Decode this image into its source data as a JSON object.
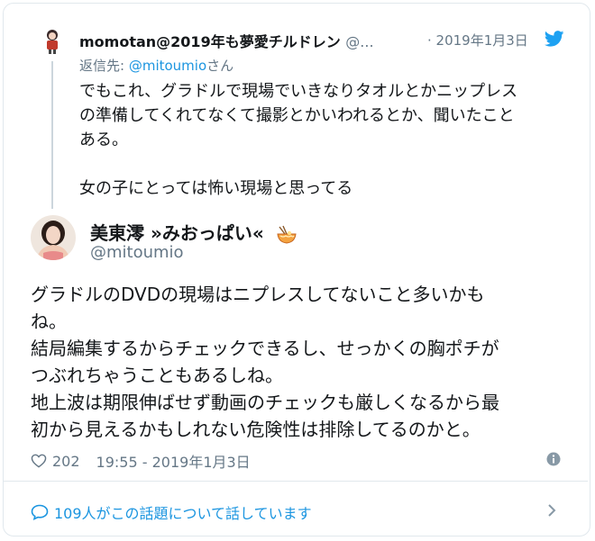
{
  "reply": {
    "display_name": "momotan@2019年も夢愛チルドレン",
    "handle": "@...",
    "date": "· 2019年1月3日",
    "reply_prefix": "返信先: ",
    "reply_mention": "@mitoumio",
    "reply_suffix": "さん",
    "text": "でもこれ、グラドルで現場でいきなりタオルとかニップレス\nの準備してくれてなくて撮影とかいわれるとか、聞いたこと\nある。\n\n女の子にとっては怖い現場と思ってる"
  },
  "tweet": {
    "display_name": "美東澪 »みおっぱい«",
    "handle": "@mitoumio",
    "text": "グラドルのDVDの現場はニプレスしてないこと多いかも\nね。\n結局編集するからチェックできるし、せっかくの胸ポチが\nつぶれちゃうこともあるしね。\n地上波は期限伸ばせず動画のチェックも厳しくなるから最\n初から見えるかもしれない危険性は排除してるのかと。",
    "likes": "202",
    "timestamp": "19:55 - 2019年1月3日"
  },
  "footer": {
    "label": "109人がこの話題について話しています"
  },
  "icons": {
    "bird": "twitter-bird-icon",
    "heart": "heart-icon",
    "info": "info-icon",
    "bubble": "speech-bubble-icon",
    "chevron": "chevron-right-icon",
    "ramen": "ramen-bowl-icon"
  },
  "colors": {
    "accent": "#1b95e0",
    "secondary_text": "#657786",
    "border": "#e1e8ed"
  }
}
